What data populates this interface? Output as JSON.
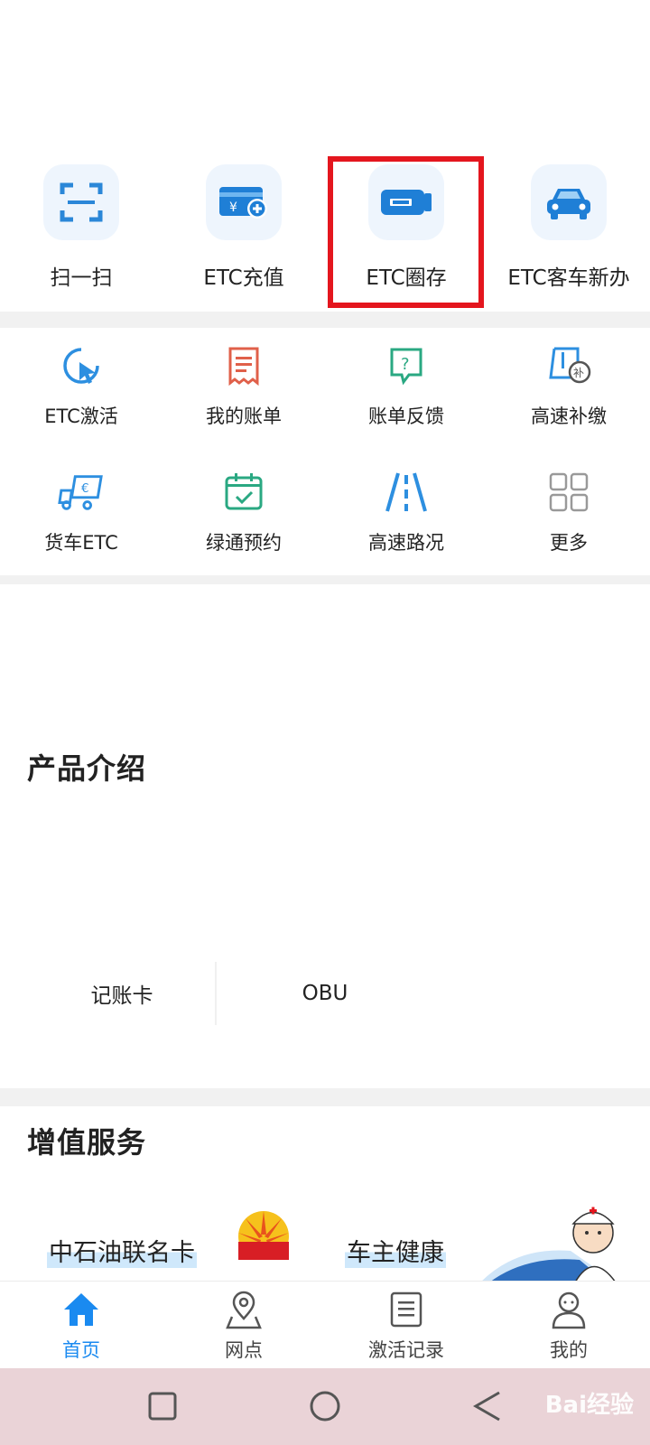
{
  "primary_actions": [
    {
      "id": "scan",
      "label": "扫一扫",
      "icon": "scan-icon"
    },
    {
      "id": "recharge",
      "label": "ETC充值",
      "icon": "recharge-card-icon"
    },
    {
      "id": "quancun",
      "label": "ETC圈存",
      "icon": "etc-card-icon"
    },
    {
      "id": "new",
      "label": "ETC客车新办",
      "icon": "car-icon"
    }
  ],
  "grid_items": [
    {
      "label": "ETC激活",
      "icon": "activate-icon"
    },
    {
      "label": "我的账单",
      "icon": "bill-icon"
    },
    {
      "label": "账单反馈",
      "icon": "feedback-icon"
    },
    {
      "label": "高速补缴",
      "icon": "repay-icon"
    },
    {
      "label": "货车ETC",
      "icon": "truck-icon"
    },
    {
      "label": "绿通预约",
      "icon": "calendar-icon"
    },
    {
      "label": "高速路况",
      "icon": "road-icon"
    },
    {
      "label": "更多",
      "icon": "grid-more-icon"
    }
  ],
  "product_section": {
    "title": "产品介绍",
    "tabs": [
      "记账卡",
      "OBU"
    ]
  },
  "value_section": {
    "title": "增值服务",
    "cards": [
      "中石油联名卡",
      "车主健康"
    ]
  },
  "tabbar": [
    {
      "label": "首页",
      "icon": "home-icon",
      "active": true
    },
    {
      "label": "网点",
      "icon": "location-icon",
      "active": false
    },
    {
      "label": "激活记录",
      "icon": "record-icon",
      "active": false
    },
    {
      "label": "我的",
      "icon": "profile-icon",
      "active": false
    }
  ],
  "watermark": "Bai经验",
  "colors": {
    "accent": "#1a8af0",
    "highlight": "#e4161e",
    "nav_bg": "#ead3d7"
  }
}
